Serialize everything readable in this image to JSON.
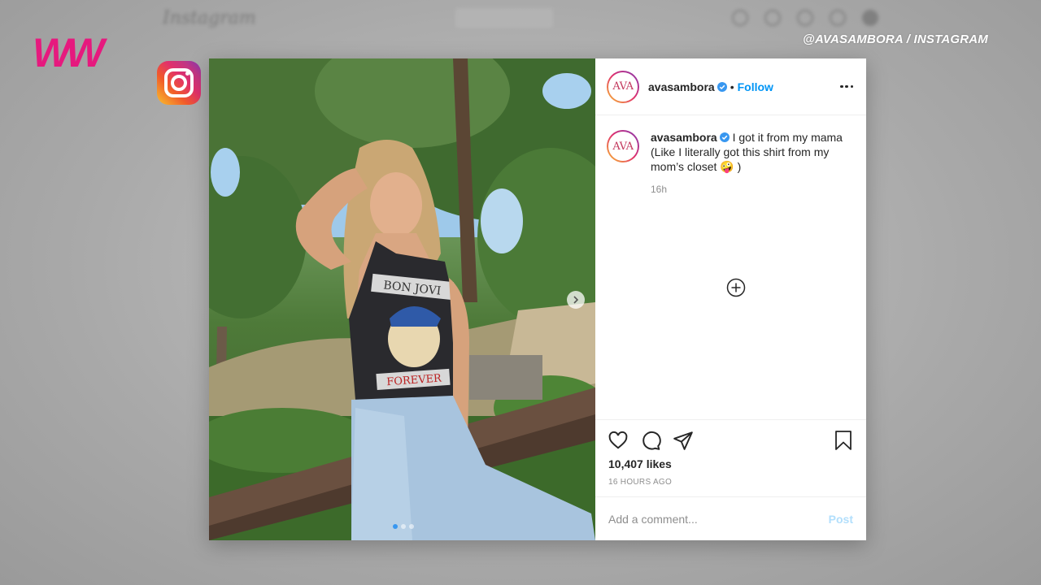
{
  "background": {
    "wordmark": "Instagram"
  },
  "brand": {
    "logo_text": "WW",
    "color": "#e6197e"
  },
  "watermark": "@AVASAMBORA / INSTAGRAM",
  "post": {
    "username": "avasambora",
    "avatar_text": "AVA",
    "separator": "•",
    "follow_label": "Follow",
    "caption": "I got it from my mama (Like I literally got this shirt from my mom’s closet 🤪 )",
    "caption_time": "16h",
    "likes": "10,407 likes",
    "time_ago": "16 HOURS AGO",
    "comment_placeholder": "Add a comment...",
    "post_label": "Post",
    "carousel": {
      "count": 3,
      "active": 1
    },
    "shirt_text_top": "BON JOVI",
    "shirt_text_bottom": "FOREVER"
  },
  "icons": [
    "instagram-logo-icon",
    "verified-badge-icon",
    "more-options-icon",
    "add-circle-icon",
    "heart-icon",
    "comment-icon",
    "share-icon",
    "bookmark-icon",
    "chevron-right-icon"
  ],
  "colors": {
    "link_blue": "#0095f6",
    "verified_blue": "#3897f0",
    "text": "#262626",
    "muted": "#8e8e8e"
  }
}
